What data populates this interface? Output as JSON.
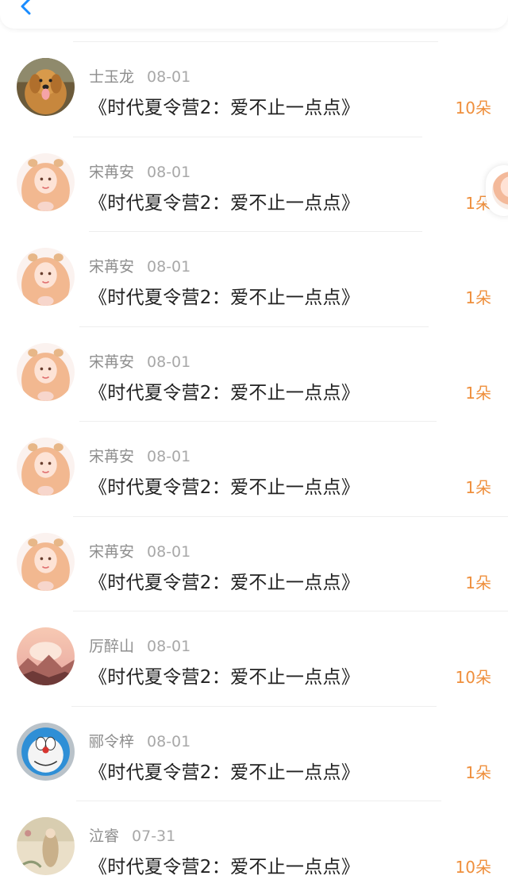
{
  "header": {
    "back_icon": "chevron-left-icon"
  },
  "colors": {
    "accent": "#1a8cff",
    "count": "#ef8f3c",
    "name": "#8e8e8e",
    "title": "#222222"
  },
  "items": [
    {
      "name": "士玉龙",
      "date": "08-01",
      "title": "《时代夏令营2：爱不止一点点》",
      "count": "10朵",
      "avatar": "dog"
    },
    {
      "name": "宋苒安",
      "date": "08-01",
      "title": "《时代夏令营2：爱不止一点点》",
      "count": "1朵",
      "avatar": "girl"
    },
    {
      "name": "宋苒安",
      "date": "08-01",
      "title": "《时代夏令营2：爱不止一点点》",
      "count": "1朵",
      "avatar": "girl"
    },
    {
      "name": "宋苒安",
      "date": "08-01",
      "title": "《时代夏令营2：爱不止一点点》",
      "count": "1朵",
      "avatar": "girl"
    },
    {
      "name": "宋苒安",
      "date": "08-01",
      "title": "《时代夏令营2：爱不止一点点》",
      "count": "1朵",
      "avatar": "girl"
    },
    {
      "name": "宋苒安",
      "date": "08-01",
      "title": "《时代夏令营2：爱不止一点点》",
      "count": "1朵",
      "avatar": "girl"
    },
    {
      "name": "厉醉山",
      "date": "08-01",
      "title": "《时代夏令营2：爱不止一点点》",
      "count": "10朵",
      "avatar": "landscape"
    },
    {
      "name": "郦令梓",
      "date": "08-01",
      "title": "《时代夏令营2：爱不止一点点》",
      "count": "1朵",
      "avatar": "doraemon"
    },
    {
      "name": "泣睿",
      "date": "07-31",
      "title": "《时代夏令营2：爱不止一点点》",
      "count": "10朵",
      "avatar": "painting"
    }
  ]
}
